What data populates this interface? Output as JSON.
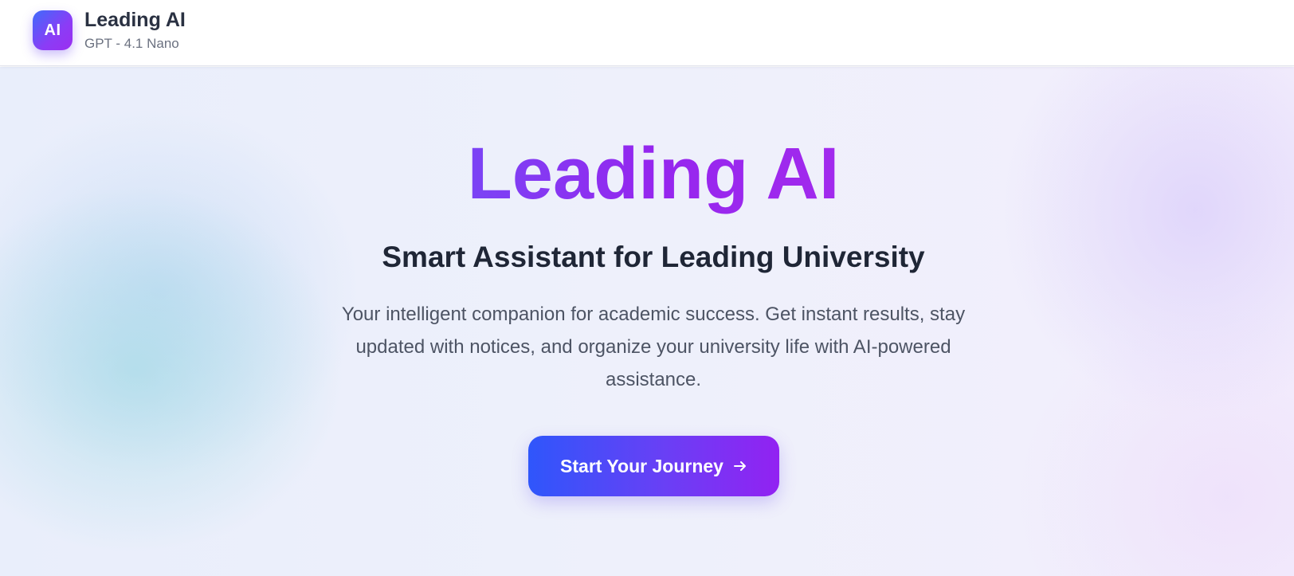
{
  "header": {
    "logo_text": "AI",
    "title": "Leading AI",
    "subtitle": "GPT - 4.1 Nano"
  },
  "hero": {
    "title": "Leading AI",
    "subtitle": "Smart Assistant for Leading University",
    "description": "Your intelligent companion for academic success. Get instant results, stay updated with notices, and organize your university life with AI-powered assistance.",
    "cta_label": "Start Your Journey",
    "cta_icon": "arrow-right-icon"
  },
  "colors": {
    "accent_start": "#2f56fb",
    "accent_end": "#9222f2",
    "title_purple": "#9526ee"
  }
}
